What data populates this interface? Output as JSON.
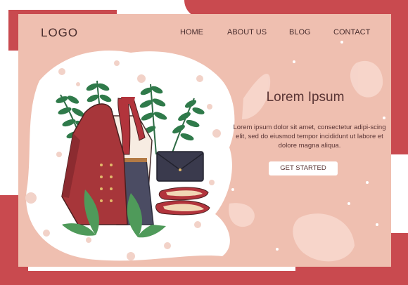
{
  "nav": {
    "logo": "LOGO",
    "links": [
      "HOME",
      "ABOUT US",
      "BLOG",
      "CONTACT"
    ]
  },
  "hero": {
    "title": "Lorem Ipsum",
    "text": "Lorem ipsum dolor sit amet, consectetur adipi-scing elit, sed do eiusmod tempor incididunt ut labore et dolore magna aliqua.",
    "button_label": "GET STARTED"
  },
  "colors": {
    "accent_red": "#c94a4f",
    "background_pink": "#efbfb0",
    "text_brown": "#5a3535"
  },
  "illustration": {
    "items": [
      "coat-icon",
      "scarf-icon",
      "blouse-icon",
      "skirt-icon",
      "clutch-bag-icon",
      "flat-shoes-icon",
      "fern-leaf-icon",
      "monstera-leaf-icon"
    ]
  }
}
